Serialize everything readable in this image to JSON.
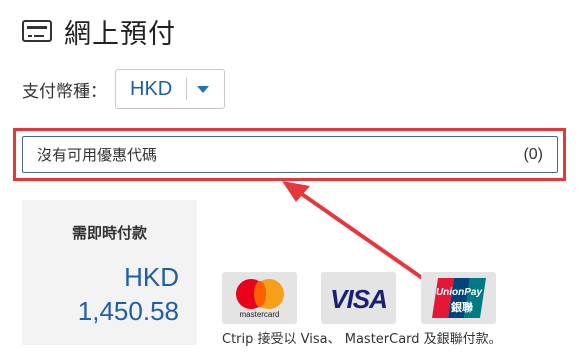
{
  "header": {
    "title": "網上預付",
    "icon": "credit-card-icon"
  },
  "currency": {
    "label": "支付幣種：",
    "selected": "HKD"
  },
  "promo": {
    "label": "沒有可用優惠代碼",
    "count": "(0)"
  },
  "payment": {
    "label": "需即時付款",
    "currency": "HKD",
    "amount": "1,450.58"
  },
  "cards": {
    "mastercard_label": "mastercard",
    "visa_label": "VISA",
    "unionpay_label": "UnionPay",
    "unionpay_sub": "銀聯",
    "accepted_text": "Ctrip 接受以 Visa、 MasterCard 及銀聯付款。"
  },
  "colors": {
    "accent": "#1f5fa8",
    "highlight": "#e5383b",
    "panel": "#f3f3f3"
  }
}
